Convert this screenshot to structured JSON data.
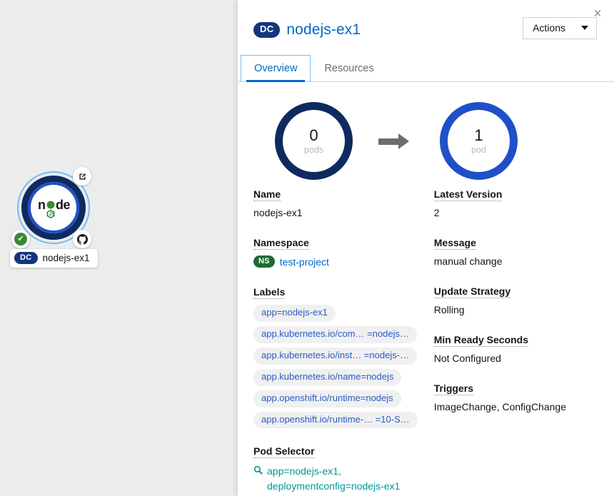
{
  "topology": {
    "node": {
      "icon": "nodejs-logo",
      "runtime_label": "node",
      "badges": {
        "open_url": "external-link-icon",
        "source_repo": "github-icon",
        "status": "check-circle-icon"
      },
      "kind_badge": "DC",
      "name": "nodejs-ex1"
    }
  },
  "panel": {
    "close_label": "×",
    "kind_badge": "DC",
    "title": "nodejs-ex1",
    "actions": {
      "label": "Actions",
      "caret": "chevron-down-icon"
    },
    "tabs": [
      {
        "label": "Overview",
        "active": true
      },
      {
        "label": "Resources",
        "active": false
      }
    ],
    "donuts": {
      "previous": {
        "count": "0",
        "label": "pods",
        "color": "#0f2a5e"
      },
      "arrow": "arrow-right-icon",
      "current": {
        "count": "1",
        "label": "pod",
        "color": "#1f50c8"
      }
    },
    "details": {
      "name": {
        "term": "Name",
        "value": "nodejs-ex1"
      },
      "namespace": {
        "term": "Namespace",
        "badge": "NS",
        "value": "test-project"
      },
      "labels": {
        "term": "Labels",
        "items": [
          "app=nodejs-ex1",
          "app.kubernetes.io/com… =nodejs…",
          "app.kubernetes.io/inst… =nodejs-…",
          "app.kubernetes.io/name=nodejs",
          "app.openshift.io/runtime=nodejs",
          "app.openshift.io/runtime-… =10-S…"
        ]
      },
      "pod_selector": {
        "term": "Pod Selector",
        "icon": "search-icon",
        "line1": "app=nodejs-ex1,",
        "line2": "deploymentconfig=nodejs-ex1"
      },
      "latest_version": {
        "term": "Latest Version",
        "value": "2"
      },
      "message": {
        "term": "Message",
        "value": "manual change"
      },
      "update_strategy": {
        "term": "Update Strategy",
        "value": "Rolling"
      },
      "min_ready_seconds": {
        "term": "Min Ready Seconds",
        "value": "Not Configured"
      },
      "triggers": {
        "term": "Triggers",
        "value": "ImageChange, ConfigChange"
      }
    }
  }
}
